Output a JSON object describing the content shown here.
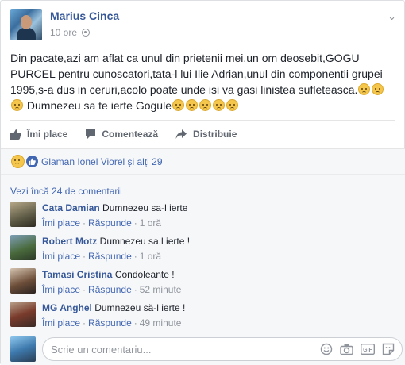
{
  "post": {
    "author": "Marius Cinca",
    "time": "10 ore",
    "text": "Din pacate,azi am aflat ca unul din prietenii mei,un om deosebit,GOGU PURCEL pentru cunoscatori,tata-l lui Ilie Adrian,unul din componentii grupei 1995,s-a dus in ceruri,acolo poate unde isi va gasi linistea sufleteasca.",
    "text_end": "Dumnezeu sa te ierte Gogule"
  },
  "actions": {
    "like": "Îmi place",
    "comment": "Comentează",
    "share": "Distribuie"
  },
  "reactions": {
    "text": "Glaman Ionel Viorel și alți 29"
  },
  "comments": {
    "more": "Vezi încă 24 de comentarii",
    "like_label": "Îmi place",
    "reply_label": "Răspunde",
    "items": [
      {
        "name": "Cata Damian",
        "text": "Dumnezeu sa-l ierte",
        "ago": "1 oră"
      },
      {
        "name": "Robert Motz",
        "text": "Dumnezeu sa.l ierte !",
        "ago": "1 oră"
      },
      {
        "name": "Tamasi Cristina",
        "text": "Condoleante !",
        "ago": "52 minute"
      },
      {
        "name": "MG Anghel",
        "text": "Dumnezeu să-l ierte !",
        "ago": "49 minute"
      }
    ],
    "placeholder": "Scrie un comentariu..."
  },
  "icons": [
    "globe-icon",
    "chevron-down-icon",
    "like-icon",
    "comment-icon",
    "share-icon",
    "sad-emoji-icon",
    "emoji-icon",
    "camera-icon",
    "gif-icon",
    "sticker-icon"
  ],
  "colors": {
    "link": "#365899",
    "accent": "#4267b2",
    "muted": "#90949c"
  }
}
